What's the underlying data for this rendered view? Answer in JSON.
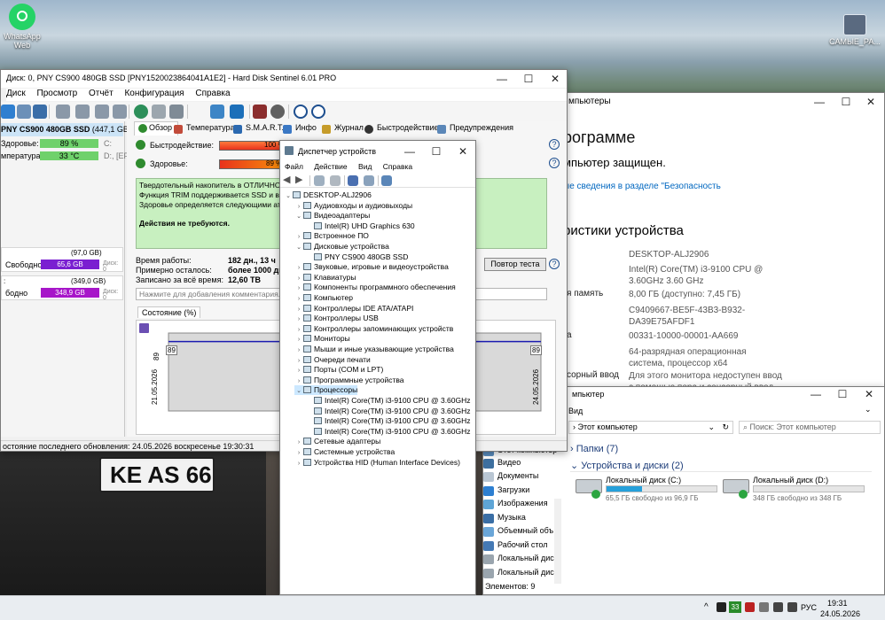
{
  "desktop": {
    "icon1_label": "WhatsApp Web",
    "icon2_label": "САМЫЕ_РА..."
  },
  "hds": {
    "title": "Диск: 0, PNY CS900 480GB SSD [PNY1520023864041A1E2] - Hard Disk Sentinel 6.01 PRO",
    "menu": [
      "Диск",
      "Просмотр",
      "Отчёт",
      "Конфигурация",
      "Справка"
    ],
    "disk": {
      "name": "PNY CS900 480GB SSD",
      "size": "(447,1 GB)",
      "disk_label": "Диск: 0",
      "health_label": "Здоровье:",
      "health_value": "89 %",
      "health_drive": "C:",
      "temp_label": "мпература:",
      "temp_value": "33 °C",
      "temp_drive": "D:, [EFI]"
    },
    "vol1": {
      "size": "(97,0 GB)",
      "free_label": "Свободно",
      "free_value": "65,6 GB",
      "disk_ref": "Диск: 0"
    },
    "vol2": {
      "prefix": ":",
      "size": "(349,0 GB)",
      "free_label": "бодно",
      "free_value": "348,9 GB",
      "disk_ref": "Диск: 0"
    },
    "tabs": [
      "Обзор",
      "Температура",
      "S.M.A.R.T.",
      "Инфо",
      "Журнал",
      "Быстродействие",
      "Предупреждения"
    ],
    "perf_label": "Быстродействие:",
    "perf_value": "100 %",
    "perf_percent": 100,
    "health_label": "Здоровье:",
    "health_value": "89 %",
    "health_percent": 89,
    "status_lines": [
      "Твердотельный накопитель в ОТЛИЧНОМ со",
      "Функция TRIM поддерживается SSD и вклю",
      "Здоровье определяется следующими атриб"
    ],
    "action_text": "Действия не требуются.",
    "work_time_label": "Время работы:",
    "work_time_value": "182 дн., 13 ч",
    "remaining_label": "Примерно осталось:",
    "remaining_value": "более 1000 дн.",
    "written_label": "Записано за всё время:",
    "written_value": "12,60 TB",
    "retest_button": "Повтор теста",
    "comment_placeholder": "Нажмите для добавления комментария...",
    "state_tab": "Состояние (%)",
    "chart_value_left": "89",
    "chart_value_right": "89",
    "chart_y_label": "89",
    "chart_date_left": "21.05.2026",
    "chart_date_right": "24.05.2026",
    "status_bar": "остояние последнего обновления: 24.05.2026 воскресенье 19:30:31"
  },
  "devmgr": {
    "title": "Диспетчер устройств",
    "menu": [
      "Файл",
      "Действие",
      "Вид",
      "Справка"
    ],
    "root": "DESKTOP-ALJ2906",
    "tree": [
      {
        "label": "Аудиовходы и аудиовыходы",
        "level": 1,
        "exp": "›"
      },
      {
        "label": "Видеоадаптеры",
        "level": 1,
        "exp": "⌄"
      },
      {
        "label": "Intel(R) UHD Graphics 630",
        "level": 2,
        "exp": ""
      },
      {
        "label": "Встроенное ПО",
        "level": 1,
        "exp": "›"
      },
      {
        "label": "Дисковые устройства",
        "level": 1,
        "exp": "⌄"
      },
      {
        "label": "PNY CS900 480GB SSD",
        "level": 2,
        "exp": ""
      },
      {
        "label": "Звуковые, игровые и видеоустройства",
        "level": 1,
        "exp": "›"
      },
      {
        "label": "Клавиатуры",
        "level": 1,
        "exp": "›"
      },
      {
        "label": "Компоненты программного обеспечения",
        "level": 1,
        "exp": "›"
      },
      {
        "label": "Компьютер",
        "level": 1,
        "exp": "›"
      },
      {
        "label": "Контроллеры IDE ATA/ATAPI",
        "level": 1,
        "exp": "›"
      },
      {
        "label": "Контроллеры USB",
        "level": 1,
        "exp": "›"
      },
      {
        "label": "Контроллеры запоминающих устройств",
        "level": 1,
        "exp": "›"
      },
      {
        "label": "Мониторы",
        "level": 1,
        "exp": "›"
      },
      {
        "label": "Мыши и иные указывающие устройства",
        "level": 1,
        "exp": "›"
      },
      {
        "label": "Очереди печати",
        "level": 1,
        "exp": "›"
      },
      {
        "label": "Порты (COM и LPT)",
        "level": 1,
        "exp": "›"
      },
      {
        "label": "Программные устройства",
        "level": 1,
        "exp": "›"
      },
      {
        "label": "Процессоры",
        "level": 1,
        "exp": "⌄",
        "selected": true
      },
      {
        "label": "Intel(R) Core(TM) i3-9100 CPU @ 3.60GHz",
        "level": 2,
        "exp": ""
      },
      {
        "label": "Intel(R) Core(TM) i3-9100 CPU @ 3.60GHz",
        "level": 2,
        "exp": ""
      },
      {
        "label": "Intel(R) Core(TM) i3-9100 CPU @ 3.60GHz",
        "level": 2,
        "exp": ""
      },
      {
        "label": "Intel(R) Core(TM) i3-9100 CPU @ 3.60GHz",
        "level": 2,
        "exp": ""
      },
      {
        "label": "Сетевые адаптеры",
        "level": 1,
        "exp": "›"
      },
      {
        "label": "Системные устройства",
        "level": 1,
        "exp": "›"
      },
      {
        "label": "Устройства HID (Human Interface Devices)",
        "level": 1,
        "exp": "›"
      }
    ]
  },
  "sysinfo": {
    "title": "мпьютеры",
    "heading": "рограмме",
    "protected": "мпьютер защищен.",
    "link": "ые сведения в разделе \"Безопасность",
    "specs_heading": "ристики устройства",
    "rows": [
      {
        "label": "",
        "value": "DESKTOP-ALJ2906"
      },
      {
        "label": "",
        "value": "Intel(R) Core(TM) i3-9100 CPU @ 3.60GHz 3.60 GHz"
      },
      {
        "label": "я память",
        "value": "8,00 ГБ (доступно: 7,45 ГБ)"
      },
      {
        "label": "",
        "value": "C9409667-BE5F-43B3-B932-DA39E75AFDF1"
      },
      {
        "label": "а",
        "value": "00331-10000-00001-AA669"
      },
      {
        "label": "",
        "value": "64-разрядная операционная система, процессор x64"
      },
      {
        "label": "сорный ввод",
        "value": "Для этого монитора недоступен ввод с помощью пера и сенсорный ввод"
      }
    ]
  },
  "explorer": {
    "title": "мпьютер",
    "ribbon_tab": "Вид",
    "breadcrumb": "Этот компьютер",
    "search_placeholder": "Поиск: Этот компьютер",
    "folders_group": "Папки (7)",
    "drives_group": "Устройства и диски (2)",
    "drives": [
      {
        "name": "Локальный диск (C:)",
        "free": "65,5 ГБ свободно из 96,9 ГБ",
        "used_percent": 32
      },
      {
        "name": "Локальный диск (D:)",
        "free": "348 ГБ свободно из 348 ГБ",
        "used_percent": 0
      }
    ],
    "nav_items": [
      "Этот компьютер",
      "Видео",
      "Документы",
      "Загрузки",
      "Изображения",
      "Музыка",
      "Объемный объ",
      "Рабочий стол",
      "Локальный дис",
      "Локальный дис"
    ],
    "status": "Элементов: 9"
  },
  "taskbar": {
    "badge": "33",
    "lang": "РУС",
    "time": "19:31",
    "date": "24.05.2026"
  },
  "colors": {
    "accent": "#0078d7",
    "health_green": "#cde8c9",
    "perf_bar": "#f5412a",
    "free_bar": "#7a1fd1",
    "status_bg": "#c8f0c0",
    "select_bg": "#cce8ff"
  }
}
